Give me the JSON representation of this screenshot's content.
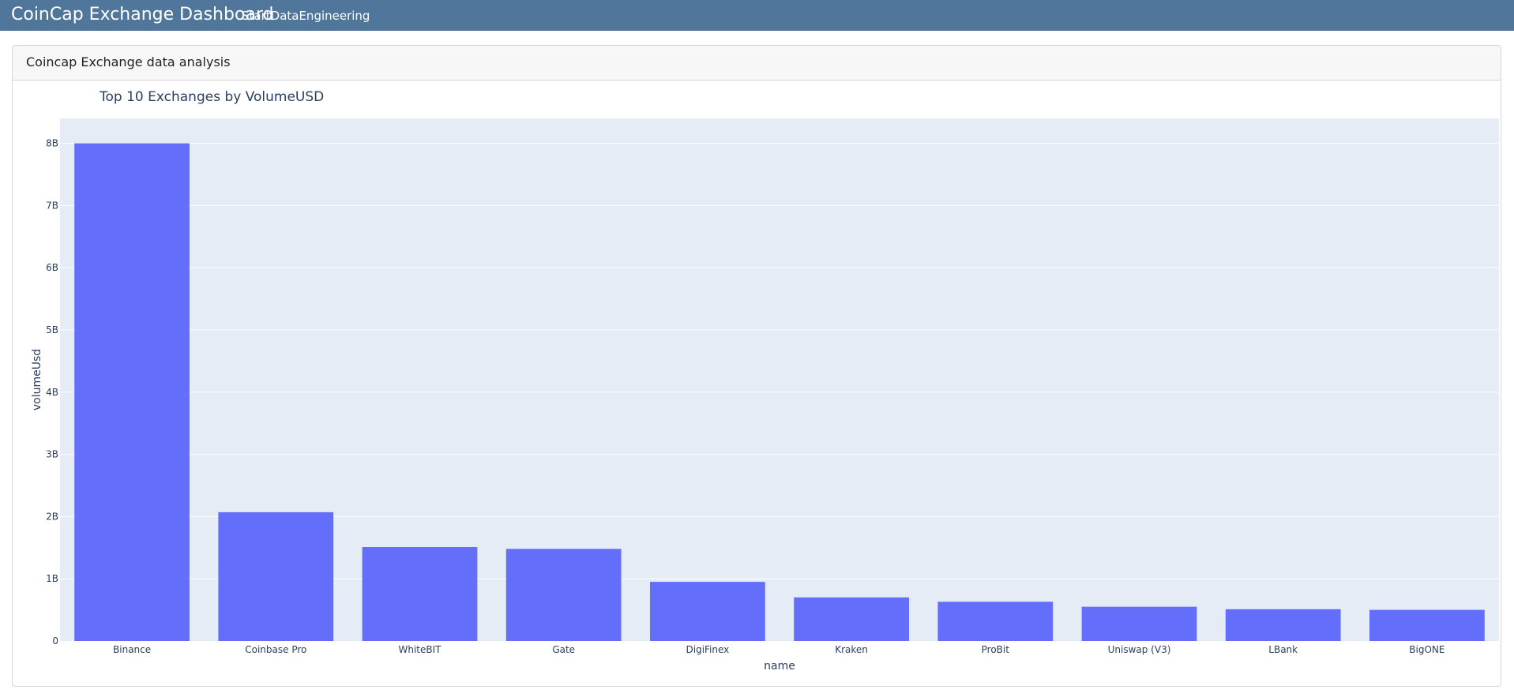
{
  "header": {
    "title": "CoinCap Exchange Dashboard",
    "subtitle": "StartDataEngineering"
  },
  "card": {
    "title": "Coincap Exchange data analysis"
  },
  "colors": {
    "topbar": "#50779b",
    "bar": "#636efa",
    "plot_bg": "#e5ecf6",
    "grid": "#ffffff",
    "text": "#2a3f5f"
  },
  "chart_data": {
    "type": "bar",
    "title": "Top 10 Exchanges by VolumeUSD",
    "xlabel": "name",
    "ylabel": "volumeUsd",
    "categories": [
      "Binance",
      "Coinbase Pro",
      "WhiteBIT",
      "Gate",
      "DigiFinex",
      "Kraken",
      "ProBit",
      "Uniswap (V3)",
      "LBank",
      "BigONE"
    ],
    "values": [
      8000000000,
      2070000000,
      1510000000,
      1480000000,
      950000000,
      700000000,
      630000000,
      550000000,
      510000000,
      500000000
    ],
    "ylim": [
      0,
      8400000000
    ],
    "yticks": [
      0,
      1000000000,
      2000000000,
      3000000000,
      4000000000,
      5000000000,
      6000000000,
      7000000000,
      8000000000
    ],
    "ytick_labels": [
      "0",
      "1B",
      "2B",
      "3B",
      "4B",
      "5B",
      "6B",
      "7B",
      "8B"
    ],
    "grid": true,
    "legend": "none"
  }
}
